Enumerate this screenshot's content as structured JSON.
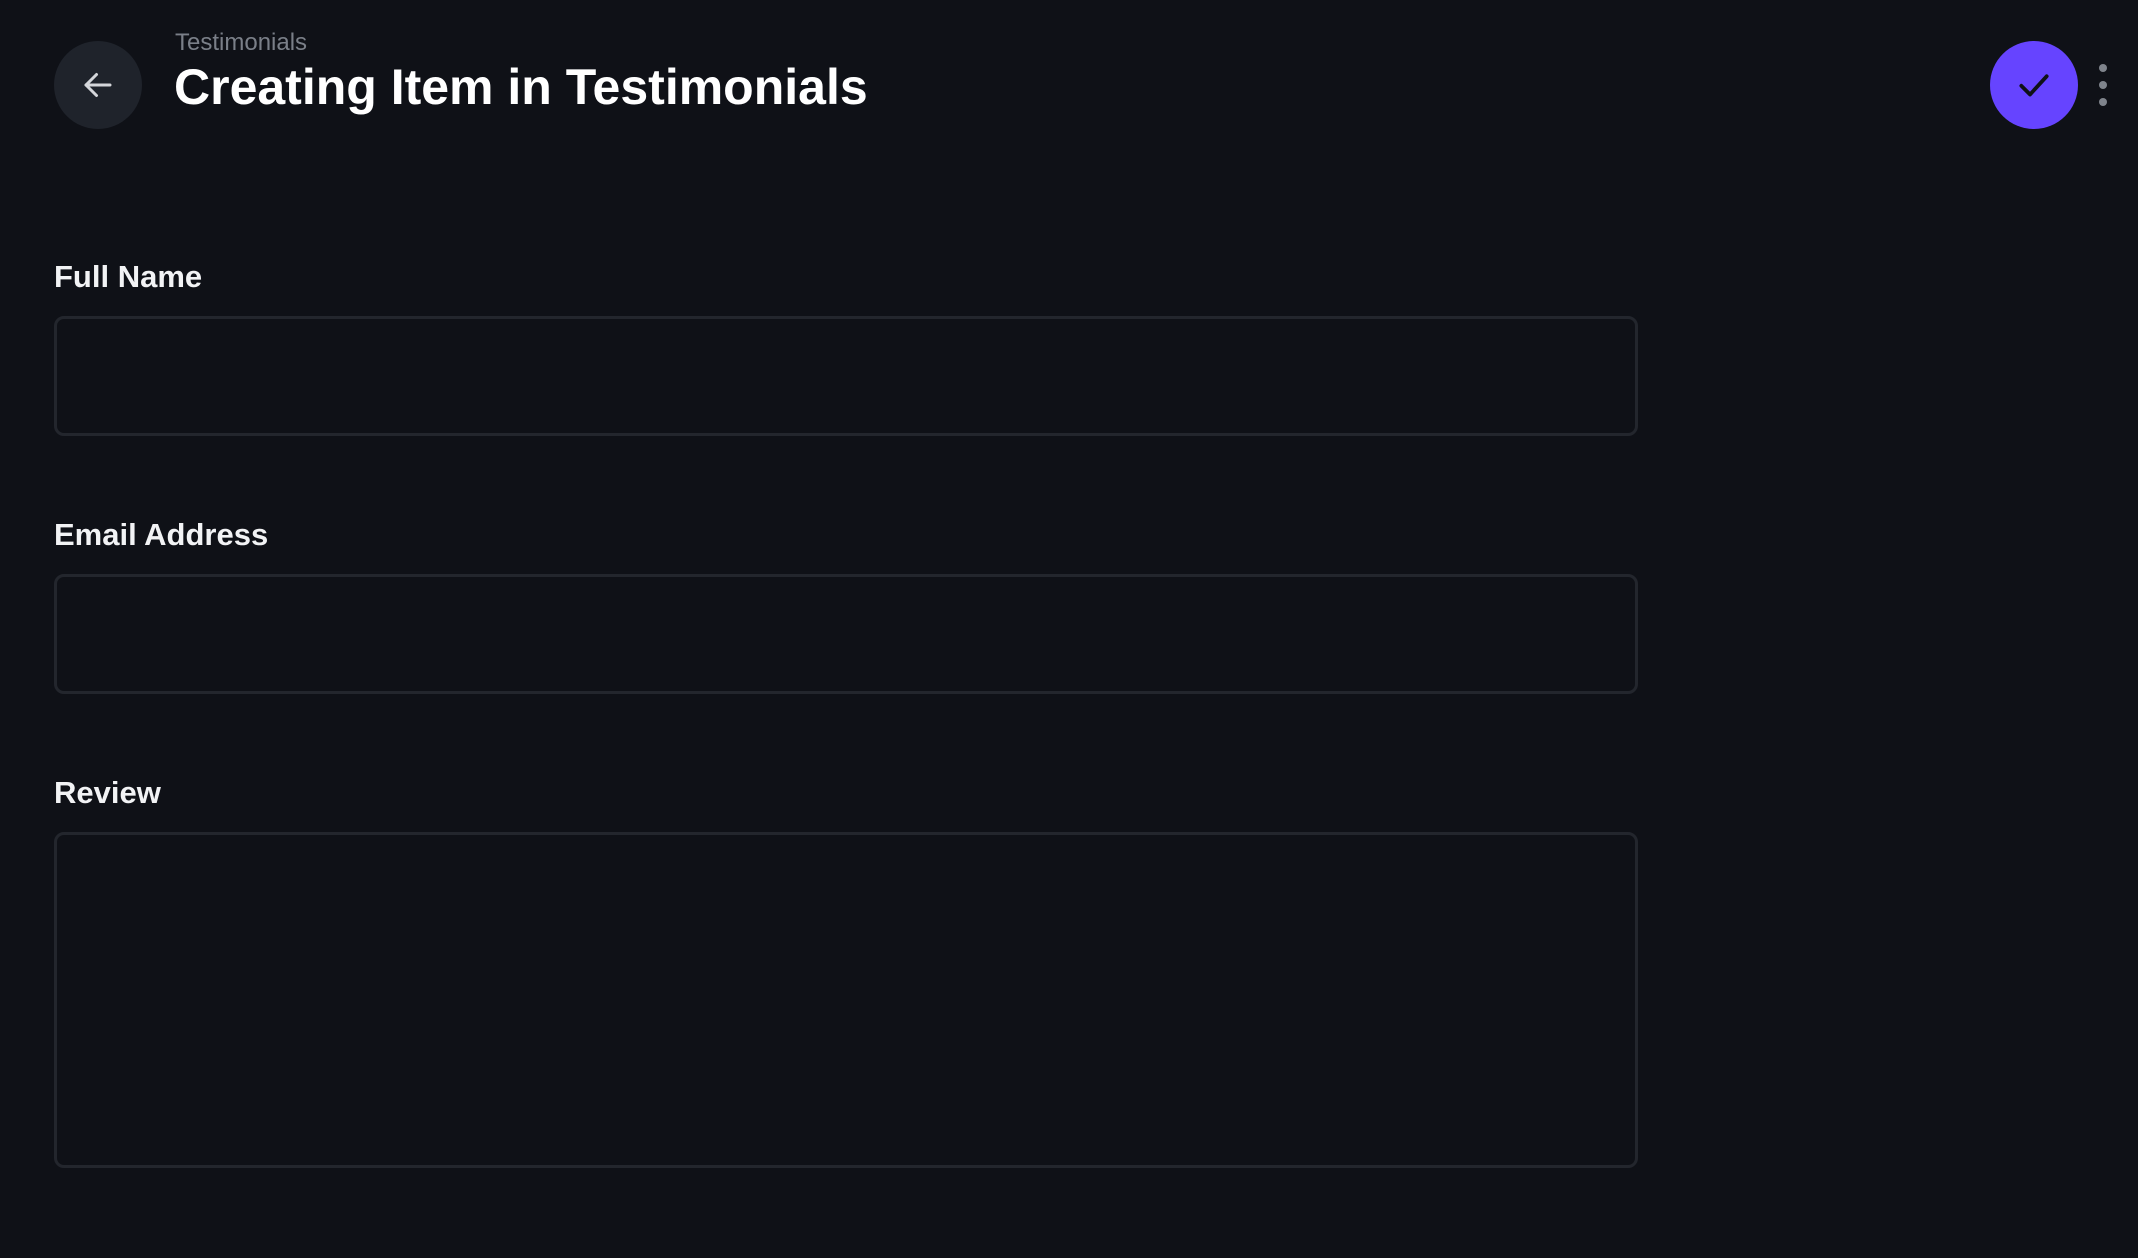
{
  "header": {
    "breadcrumb": "Testimonials",
    "title": "Creating Item in Testimonials",
    "back_icon": "arrow-left-icon",
    "save_icon": "check-icon",
    "more_icon": "more-vertical-icon"
  },
  "form": {
    "fields": [
      {
        "label": "Full Name",
        "value": "",
        "placeholder": ""
      },
      {
        "label": "Email Address",
        "value": "",
        "placeholder": ""
      },
      {
        "label": "Review",
        "value": "",
        "placeholder": ""
      }
    ]
  },
  "colors": {
    "background": "#0f1117",
    "accent": "#6644ff",
    "back_button_bg": "#1f232b",
    "field_border": "#23262d",
    "muted_text": "#7a7f88"
  }
}
